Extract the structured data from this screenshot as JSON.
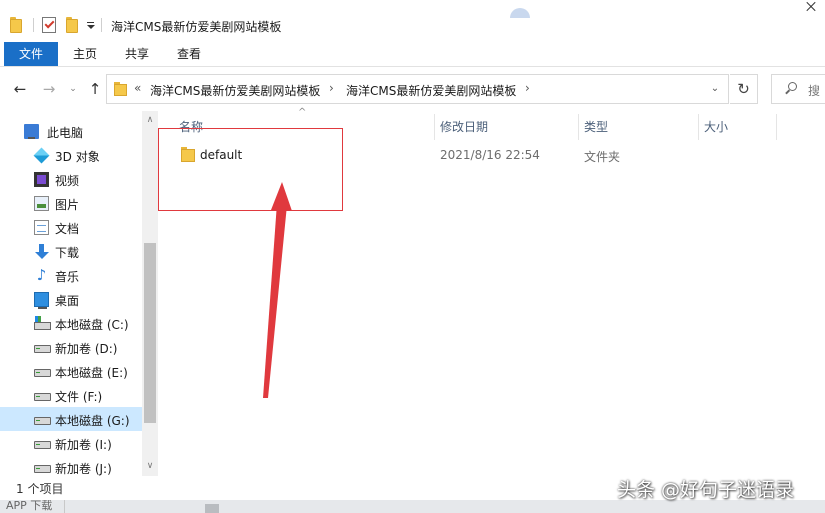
{
  "window": {
    "title": "海洋CMS最新仿爱美剧网站模板",
    "quick_access": [
      "folder-icon",
      "properties-icon",
      "new-folder-icon",
      "customize-dropdown-icon"
    ]
  },
  "ribbon": {
    "tabs": [
      {
        "label": "文件",
        "active": true
      },
      {
        "label": "主页"
      },
      {
        "label": "共享"
      },
      {
        "label": "查看"
      }
    ],
    "file_tab_color": "#1a6fc7"
  },
  "address": {
    "overflow": "«",
    "crumbs": [
      "海洋CMS最新仿爱美剧网站模板",
      "海洋CMS最新仿爱美剧网站模板"
    ],
    "separator": "›",
    "search_placeholder": "搜"
  },
  "nav": {
    "items": [
      {
        "label": "此电脑",
        "icon": "this-pc-icon",
        "root": true
      },
      {
        "label": "3D 对象",
        "icon": "3d-objects-icon"
      },
      {
        "label": "视频",
        "icon": "videos-icon"
      },
      {
        "label": "图片",
        "icon": "pictures-icon"
      },
      {
        "label": "文档",
        "icon": "documents-icon"
      },
      {
        "label": "下载",
        "icon": "downloads-icon"
      },
      {
        "label": "音乐",
        "icon": "music-icon"
      },
      {
        "label": "桌面",
        "icon": "desktop-icon"
      },
      {
        "label": "本地磁盘 (C:)",
        "icon": "system-drive-icon"
      },
      {
        "label": "新加卷 (D:)",
        "icon": "drive-icon"
      },
      {
        "label": "本地磁盘 (E:)",
        "icon": "drive-icon"
      },
      {
        "label": "文件 (F:)",
        "icon": "drive-icon"
      },
      {
        "label": "本地磁盘 (G:)",
        "icon": "drive-icon",
        "selected": true
      },
      {
        "label": "新加卷 (I:)",
        "icon": "drive-icon"
      },
      {
        "label": "新加卷 (J:)",
        "icon": "drive-icon"
      }
    ]
  },
  "columns": [
    {
      "label": "名称"
    },
    {
      "label": "修改日期"
    },
    {
      "label": "类型"
    },
    {
      "label": "大小"
    }
  ],
  "rows": [
    {
      "name": "default",
      "modified": "2021/8/16 22:54",
      "type": "文件夹",
      "size": ""
    }
  ],
  "annotation": {
    "highlight_color": "#e0393e",
    "arrow_color": "#e0393e"
  },
  "status": {
    "item_count": "1 个项目"
  },
  "taskbar": {
    "label": "APP 下载"
  },
  "watermark": "头条 @好句子迷语录"
}
